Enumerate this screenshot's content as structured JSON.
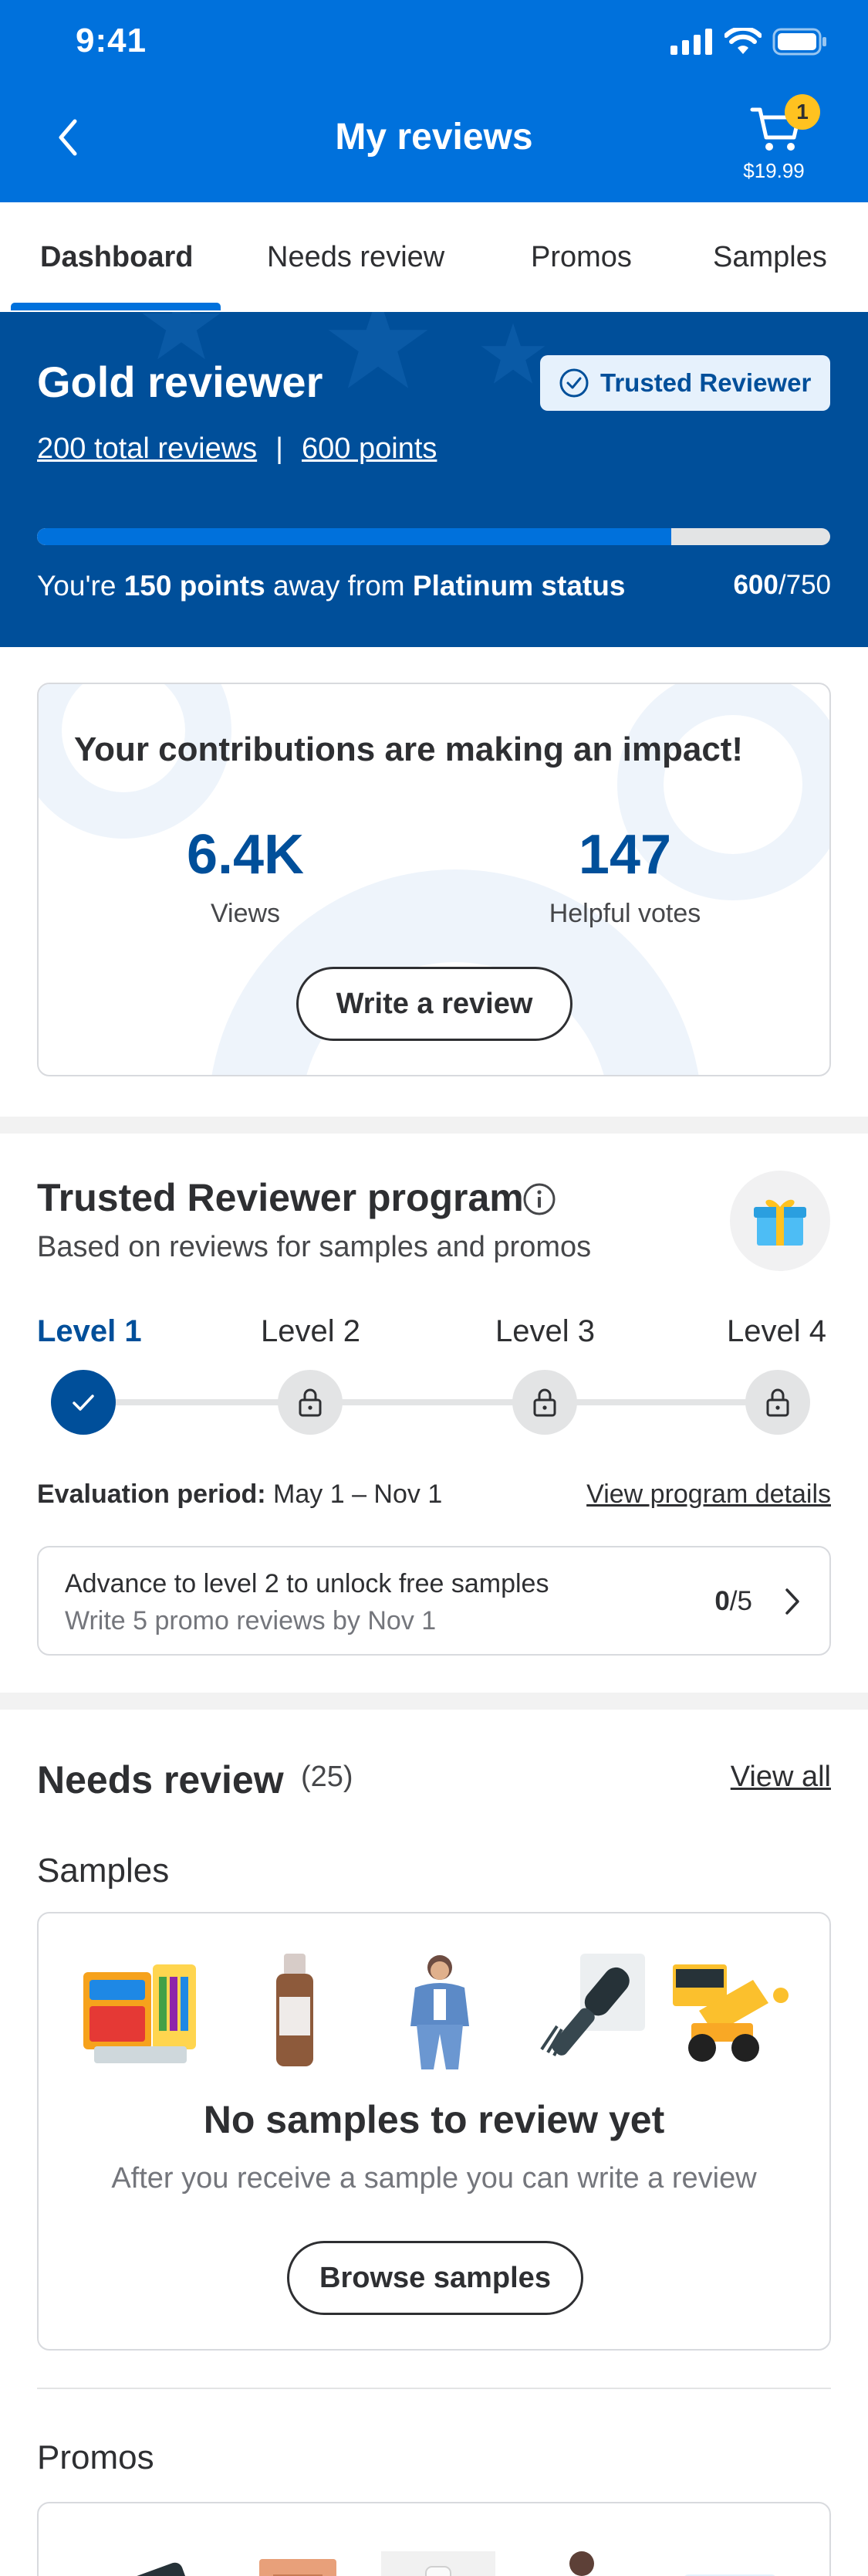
{
  "status_bar": {
    "time": "9:41"
  },
  "header": {
    "title": "My reviews",
    "cart": {
      "count": "1",
      "total": "$19.99"
    }
  },
  "tabs": [
    {
      "label": "Dashboard",
      "active": true
    },
    {
      "label": "Needs review",
      "active": false
    },
    {
      "label": "Promos",
      "active": false
    },
    {
      "label": "Samples",
      "active": false
    }
  ],
  "status_banner": {
    "title": "Gold reviewer",
    "badge": "Trusted Reviewer",
    "total_reviews": "200 total reviews",
    "separator": "|",
    "points": "600 points",
    "progress_fraction": 0.8,
    "message_pre": "You're ",
    "message_points": "150 points",
    "message_mid": " away from ",
    "message_tier": "Platinum status",
    "current": "600",
    "goal": "/750",
    "colors": {
      "background": "#004f9a",
      "accent": "#0071dc"
    }
  },
  "impact": {
    "title": "Your contributions are making an impact!",
    "stats": [
      {
        "value": "6.4K",
        "label": "Views"
      },
      {
        "value": "147",
        "label": "Helpful votes"
      }
    ],
    "button": "Write a review"
  },
  "program": {
    "title": "Trusted Reviewer program",
    "subtitle": "Based on reviews for samples and promos",
    "levels": [
      {
        "label": "Level 1",
        "state": "complete"
      },
      {
        "label": "Level 2",
        "state": "locked"
      },
      {
        "label": "Level 3",
        "state": "locked"
      },
      {
        "label": "Level 4",
        "state": "locked"
      }
    ],
    "evaluation_label": "Evaluation period:",
    "evaluation_value": " May 1 – Nov 1",
    "details_link": "View program details",
    "advance": {
      "title": "Advance to level 2 to unlock free samples",
      "subtitle": "Write 5 promo reviews by Nov 1",
      "count": "0",
      "total": "/5"
    }
  },
  "needs_review": {
    "title": "Needs review",
    "count": "(25)",
    "view_all": "View all",
    "samples": {
      "label": "Samples",
      "thumbnails": [
        "crafts-kit",
        "serum-bottle",
        "denim-outfit",
        "hair-dryer-brush",
        "toy-dump-truck"
      ],
      "empty_title": "No samples to review yet",
      "empty_subtitle": "After you receive a sample you can write a review",
      "button": "Browse samples"
    },
    "promos": {
      "label": "Promos",
      "thumbnails": [
        "power-bank",
        "paper-bag",
        "white-bottle",
        "brown-shirt",
        "blue-box"
      ]
    }
  }
}
